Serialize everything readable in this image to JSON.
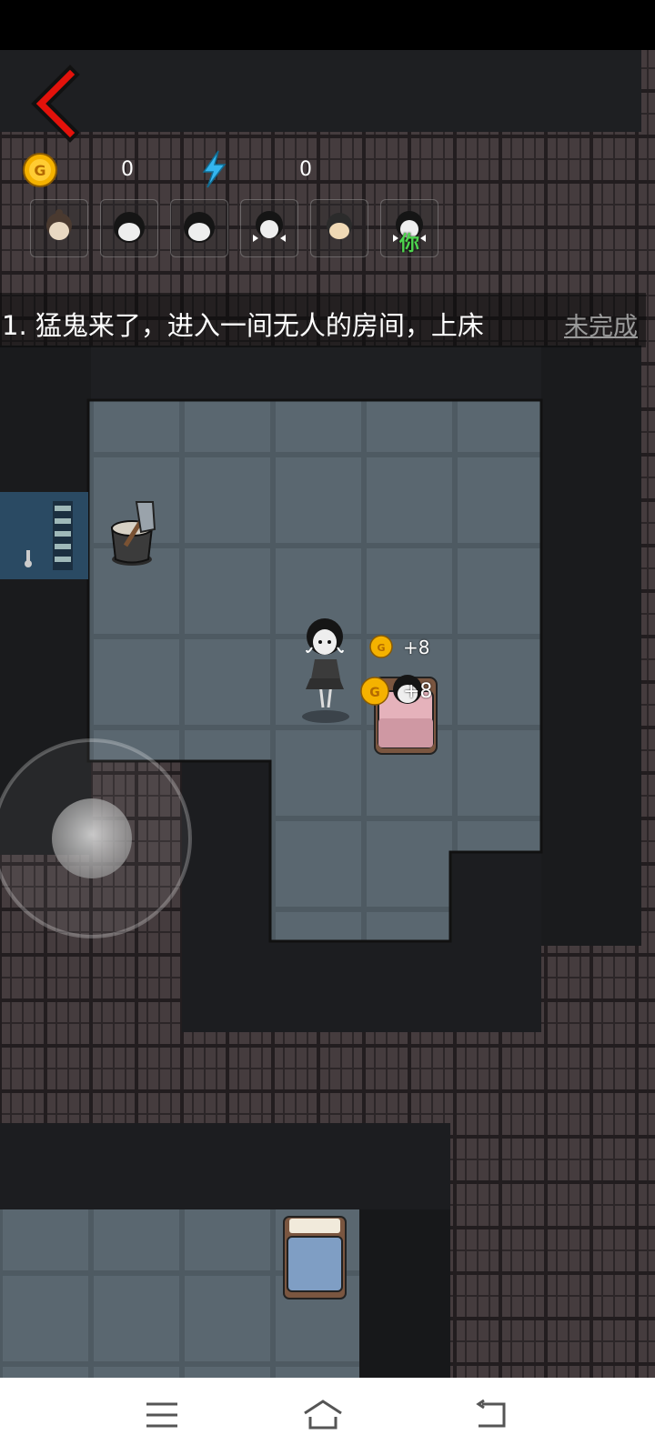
{
  "hud": {
    "coins_value": "0",
    "energy_value": "0",
    "coin_icon": "gold-coin-icon",
    "energy_icon": "lightning-bolt-icon",
    "back_icon": "red-back-arrow-icon"
  },
  "players": [
    {
      "name": "player-1",
      "label": ""
    },
    {
      "name": "player-2",
      "label": ""
    },
    {
      "name": "player-3",
      "label": ""
    },
    {
      "name": "player-4",
      "label": ""
    },
    {
      "name": "player-5",
      "label": ""
    },
    {
      "name": "player-6-you",
      "label": "你"
    }
  ],
  "task": {
    "text": "1. 猛鬼来了，进入一间无人的房间，上床",
    "status": "未完成"
  },
  "coin_pickups": [
    {
      "label": "+8"
    },
    {
      "label": "+8"
    }
  ],
  "colors": {
    "floor_tile": "#5a6872",
    "wall_dark": "#1b1c1e",
    "brick": "#3a3335",
    "accent_red": "#e3120b",
    "coin_gold": "#f5b200",
    "energy_blue": "#34b6f0"
  },
  "navbar": {
    "menu_icon": "menu-icon",
    "home_icon": "home-icon",
    "back_icon": "back-icon"
  }
}
